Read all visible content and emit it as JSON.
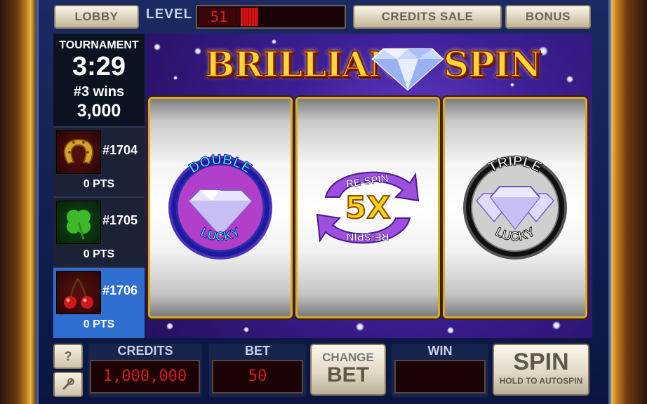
{
  "top_bar": {
    "lobby_label": "LOBBY",
    "level_label": "LEVEL",
    "level_value": "51",
    "level_progress": 0.17,
    "credits_sale_label": "CREDITS SALE",
    "bonus_label": "BONUS"
  },
  "title": {
    "left": "BRILLIANT",
    "right": "SPIN"
  },
  "tournament": {
    "title": "TOURNAMENT",
    "time": "3:29",
    "wins": "#3 wins",
    "score": "3,000",
    "entries": [
      {
        "id": "#1704",
        "points": "0 PTS",
        "icon": "horseshoe-icon",
        "highlighted": false
      },
      {
        "id": "#1705",
        "points": "0 PTS",
        "icon": "four-leaf-clover-icon",
        "highlighted": false
      },
      {
        "id": "#1706",
        "points": "0 PTS",
        "icon": "cherries-icon",
        "highlighted": true
      }
    ]
  },
  "reels": [
    {
      "symbol": "double-lucky-diamond",
      "arc_top": "DOUBLE",
      "arc_bottom": "LUCKY"
    },
    {
      "symbol": "respin-5x",
      "top": "RE-SPIN",
      "middle": "5X",
      "bottom": "RE-SPIN"
    },
    {
      "symbol": "triple-lucky-diamond",
      "arc_top": "TRIPLE",
      "arc_bottom": "LUCKY"
    }
  ],
  "bottom_bar": {
    "help_label": "?",
    "credits_label": "CREDITS",
    "credits_value": "1,000,000",
    "bet_label": "BET",
    "bet_value": "50",
    "change_bet_line1": "CHANGE",
    "change_bet_line2": "BET",
    "win_label": "WIN",
    "win_value": "",
    "spin_label": "SPIN",
    "spin_sub": "HOLD TO AUTOSPIN"
  },
  "colors": {
    "lcd_red": "#e01818",
    "gold": "#ffd637",
    "panel_blue": "#17244d",
    "highlight_blue": "#2f6fd0"
  }
}
